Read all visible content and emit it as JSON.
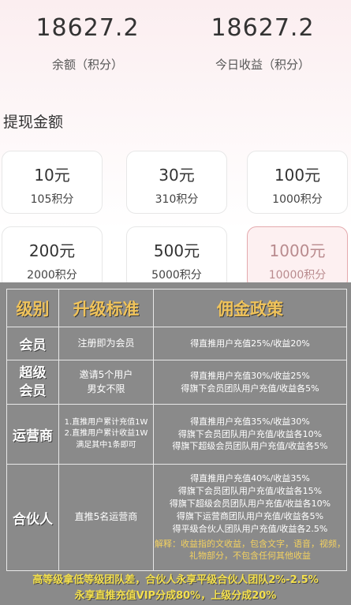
{
  "stats": {
    "balance_value": "18627.2",
    "balance_label": "余额（积分）",
    "today_value": "18627.2",
    "today_label": "今日收益（积分）"
  },
  "withdraw": {
    "title": "提现金额",
    "options": [
      {
        "amount": "10元",
        "points": "105积分",
        "selected": false
      },
      {
        "amount": "30元",
        "points": "310积分",
        "selected": false
      },
      {
        "amount": "100元",
        "points": "1000积分",
        "selected": false
      },
      {
        "amount": "200元",
        "points": "2000积分",
        "selected": false
      },
      {
        "amount": "500元",
        "points": "5000积分",
        "selected": false
      },
      {
        "amount": "1000元",
        "points": "10000积分",
        "selected": true
      }
    ]
  },
  "table": {
    "headers": [
      "级别",
      "升级标准",
      "佣金政策"
    ],
    "rows": [
      {
        "level": "会员",
        "standard": [
          "注册即为会员"
        ],
        "policy": [
          "得直推用户充值25%/收益20%"
        ]
      },
      {
        "level": "超级会员",
        "standard": [
          "邀请5个用户",
          "男女不限"
        ],
        "policy": [
          "得直推用户充值30%/收益25%",
          "得旗下会员团队用户充值/收益各5%"
        ]
      },
      {
        "level": "运营商",
        "standard": [
          "1.直推用户累计充值1W",
          "2.直推用户累计收益1W",
          "满足其中1条即可"
        ],
        "policy": [
          "得直推用户充值35%/收益30%",
          "得旗下会员团队用户充值/收益各10%",
          "得旗下超级会员团队用户充值/收益各5%"
        ]
      },
      {
        "level": "合伙人",
        "standard": [
          "直推5名运营商"
        ],
        "policy": [
          "得直推用户充值40%/收益35%",
          "得旗下会员团队用户充值/收益各15%",
          "得旗下超级会员团队用户充值/收益各10%",
          "得旗下运营商团队用户充值/收益各5%",
          "得平级合伙人团队用户充值/收益各2.5%"
        ],
        "note": "解释：收益指的文收益，包含文字，语音，视频，礼物部分，不包含任何其他收益"
      }
    ]
  },
  "footer": {
    "line1": "高等级拿低等级团队差，合伙人永享平级合伙人团队2%-2.5%",
    "line2": "永享直推充值VIP分成80%，上级分成20%"
  }
}
